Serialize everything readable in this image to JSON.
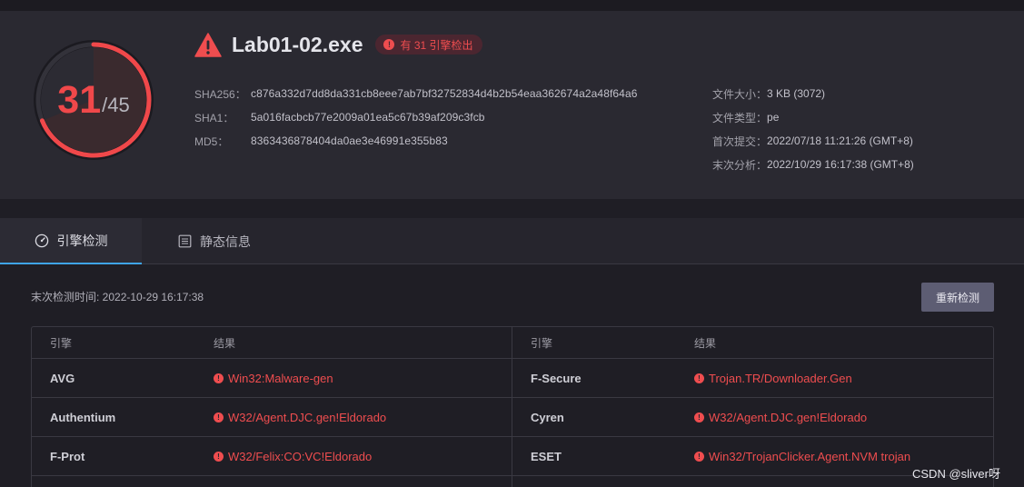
{
  "summary": {
    "detected": "31",
    "total": "/45",
    "detection_ratio": 0.689,
    "file_name": "Lab01-02.exe",
    "badge_text": "有 31 引擎检出",
    "hashes": [
      {
        "label": "SHA256：",
        "value": "c876a332d7dd8da331cb8eee7ab7bf32752834d4b2b54eaa362674a2a48f64a6"
      },
      {
        "label": "SHA1：",
        "value": "5a016facbcb77e2009a01ea5c67b39af209c3fcb"
      },
      {
        "label": "MD5：",
        "value": "8363436878404da0ae3e46991e355b83"
      }
    ],
    "meta": [
      {
        "label": "文件大小：",
        "value": "3 KB (3072)"
      },
      {
        "label": "文件类型：",
        "value": "pe"
      },
      {
        "label": "首次提交：",
        "value": "2022/07/18 11:21:26 (GMT+8)"
      },
      {
        "label": "末次分析：",
        "value": "2022/10/29 16:17:38 (GMT+8)"
      }
    ]
  },
  "tabs": [
    {
      "label": "引擎检测",
      "icon": "gauge-icon",
      "active": true
    },
    {
      "label": "静态信息",
      "icon": "document-icon",
      "active": false
    }
  ],
  "detection": {
    "last_check": "末次检测时间: 2022-10-29 16:17:38",
    "recheck_label": "重新检测",
    "headers": {
      "engine": "引擎",
      "result": "结果"
    },
    "left_rows": [
      {
        "engine": "AVG",
        "result": "Win32:Malware-gen"
      },
      {
        "engine": "Authentium",
        "result": "W32/Agent.DJC.gen!Eldorado"
      },
      {
        "engine": "F-Prot",
        "result": "W32/Felix:CO:VC!Eldorado"
      }
    ],
    "right_rows": [
      {
        "engine": "F-Secure",
        "result": "Trojan.TR/Downloader.Gen"
      },
      {
        "engine": "Cyren",
        "result": "W32/Agent.DJC.gen!Eldorado"
      },
      {
        "engine": "ESET",
        "result": "Win32/TrojanClicker.Agent.NVM trojan"
      }
    ]
  },
  "colors": {
    "alert": "#ef4d4f",
    "accent": "#3fa4e6",
    "panel": "#2a2931"
  },
  "watermark": "CSDN @sliver呀"
}
